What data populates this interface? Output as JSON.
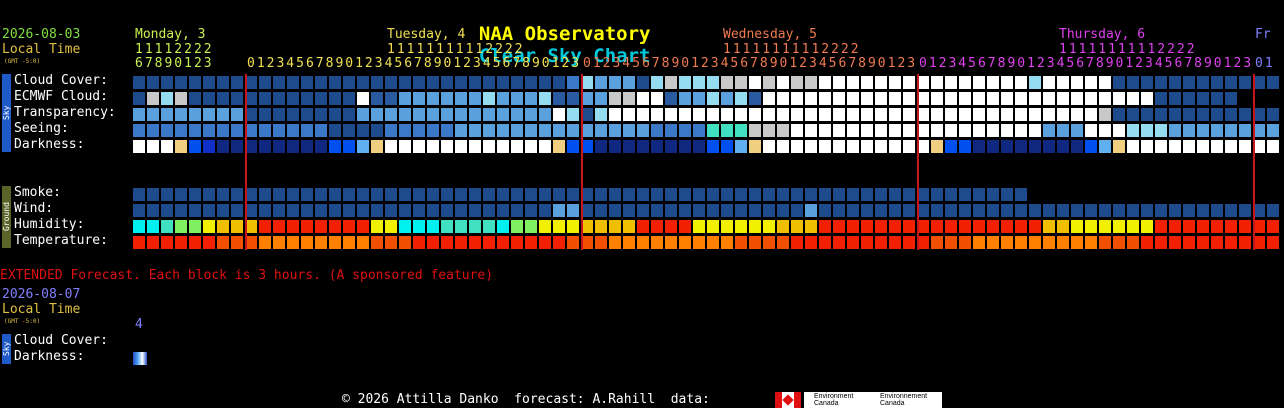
{
  "title": {
    "part1": "NAA Observatory",
    "part2": "Clear Sky Chart"
  },
  "colors": {
    "title_yellow": "#ffff00",
    "title_cyan": "#00c8dc",
    "date_green": "#80e040",
    "local_gold": "#e0c040",
    "tz_gold": "#e0c040",
    "day_mon": "#c8f050",
    "day_tue": "#f0e050",
    "day_wed": "#f07a50",
    "day_thu": "#e040f0",
    "day_fri": "#8080ff",
    "hour_pre": "#c8f050",
    "hour_tue": "#f0e050",
    "hour_wed": "#f07a50",
    "hour_thu": "#e040f0",
    "extended_red": "#e01010",
    "ext_date": "#8080ff",
    "ext_local": "#e0c040",
    "midnight_line": "#c8141e",
    "sky_tab": "#1e5ac8",
    "ground_tab": "#5a6428"
  },
  "header": {
    "date": "2026-08-03",
    "local_time": "Local Time",
    "tz": "(GMT -5:0)",
    "days": [
      {
        "label": "Monday, 3"
      },
      {
        "label": "Tuesday, 4"
      },
      {
        "label": "Wednesday, 5"
      },
      {
        "label": "Thursday, 6"
      },
      {
        "label": "Fr"
      }
    ],
    "hours_tens": [
      "11112222",
      "11111111112222",
      "11111111112222",
      "11111111112222"
    ],
    "hours_ones": [
      "67890123",
      "0123456789012345678901234567890123",
      "0123456789012345678901234567890123",
      "0123456789012345678901234567890123",
      "01"
    ]
  },
  "sky_tab": "Sky",
  "ground_tab": "Ground",
  "rows": {
    "cloud": "Cloud Cover:",
    "ecmwf": "ECMWF Cloud:",
    "transparency": "Transparency:",
    "seeing": "Seeing:",
    "darkness": "Darkness:",
    "smoke": "Smoke:",
    "wind": "Wind:",
    "humidity": "Humidity:",
    "temperature": "Temperature:"
  },
  "extended": {
    "note": "EXTENDED Forecast. Each block is 3 hours. (A sponsored feature)",
    "date": "2026-08-07",
    "local_time": "Local Time",
    "tz": "(GMT -5:0)",
    "hour": "4",
    "cloud": "Cloud Cover:",
    "darkness": "Darkness:",
    "sky_tab": "Sky"
  },
  "footer": {
    "copyright": "© 2026 Attilla Danko  forecast: A.Rahill  data:",
    "env_en": "Environment",
    "env_en2": "Canada",
    "env_fr": "Environnement",
    "env_fr2": "Canada"
  }
}
